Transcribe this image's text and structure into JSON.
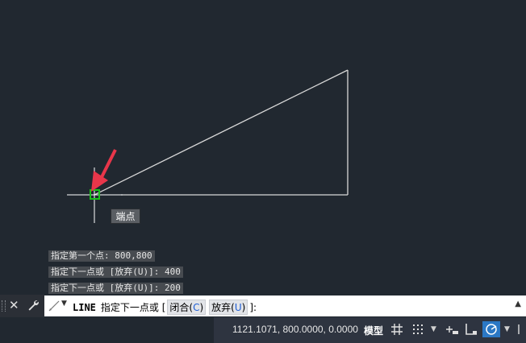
{
  "canvas": {
    "snap_tooltip": "端点",
    "background_color": "#212830",
    "line_color": "#d8d8d8",
    "snap_color": "#19c219",
    "arrow_color": "#e8364a"
  },
  "history": [
    "指定第一个点: 800,800",
    "指定下一点或 [放弃(U)]: 400",
    "指定下一点或 [放弃(U)]: 200"
  ],
  "command_line": {
    "close_icon": "close-icon",
    "settings_icon": "wrench-icon",
    "command_name": "LINE",
    "prompt": "指定下一点或 [",
    "option1_label": "闭合(",
    "option1_key": "C",
    "option1_close": ")",
    "option2_label": "放弃(",
    "option2_key": "U",
    "option2_close": ")",
    "prompt_end": "]:",
    "history_toggle": "▲"
  },
  "status_bar": {
    "coordinates": "1121.1071, 800.0000, 0.0000",
    "model_label": "模型",
    "icons": [
      "grid-icon",
      "snap-mode-icon",
      "dynamic-input-icon",
      "ortho-icon",
      "polar-tracking-icon"
    ]
  }
}
